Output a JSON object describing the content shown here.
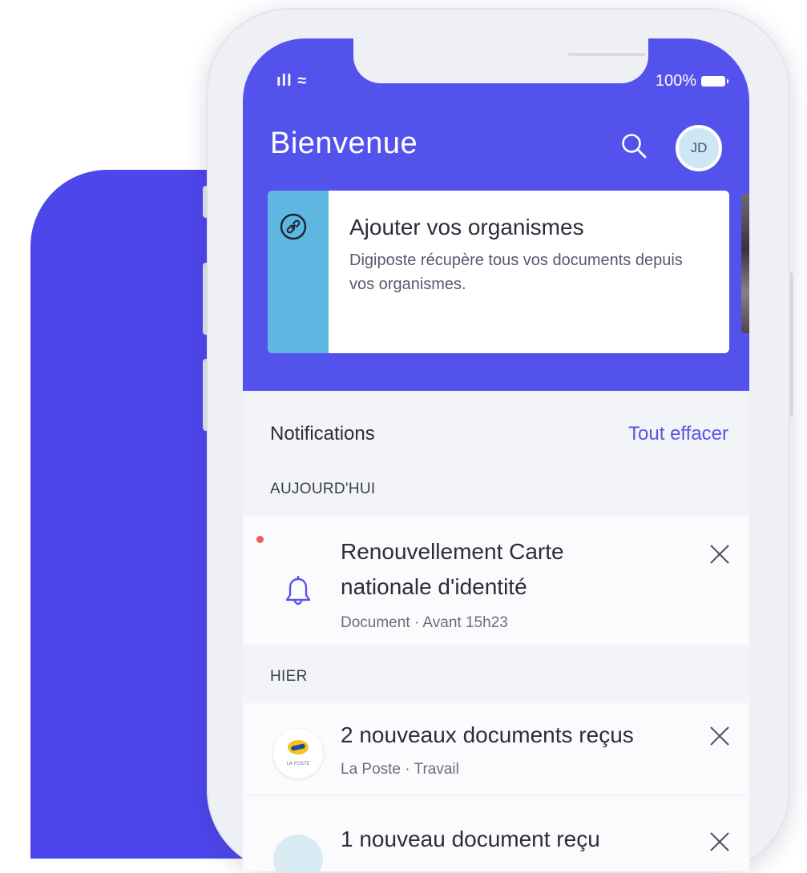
{
  "status_bar": {
    "signal": "ıll ≈",
    "battery_percent": "100%"
  },
  "header": {
    "title": "Bienvenue",
    "avatar_initials": "JD"
  },
  "promo_card": {
    "title": "Ajouter vos organismes",
    "text": "Digiposte récupère tous vos documents depuis vos organismes."
  },
  "notifications": {
    "heading": "Notifications",
    "clear_all": "Tout effacer",
    "groups": [
      {
        "label": "AUJOURD'HUI",
        "items": [
          {
            "title_line1": "Renouvellement Carte",
            "title_line2": "nationale d'identité",
            "meta": "Document · Avant 15h23",
            "unread": true,
            "icon": "bell-icon"
          }
        ]
      },
      {
        "label": "HIER",
        "items": [
          {
            "title": "2 nouveaux documents reçus",
            "meta": "La Poste · Travail",
            "icon": "la-poste-logo",
            "logo_text": "LA POSTE"
          },
          {
            "title": "1 nouveau document reçu",
            "icon": "organism-logo"
          }
        ]
      }
    ]
  },
  "colors": {
    "brand": "#5452ec",
    "blob": "#4d46ec",
    "accent_blue": "#5fb6e0",
    "unread_dot": "#ec5d55"
  }
}
